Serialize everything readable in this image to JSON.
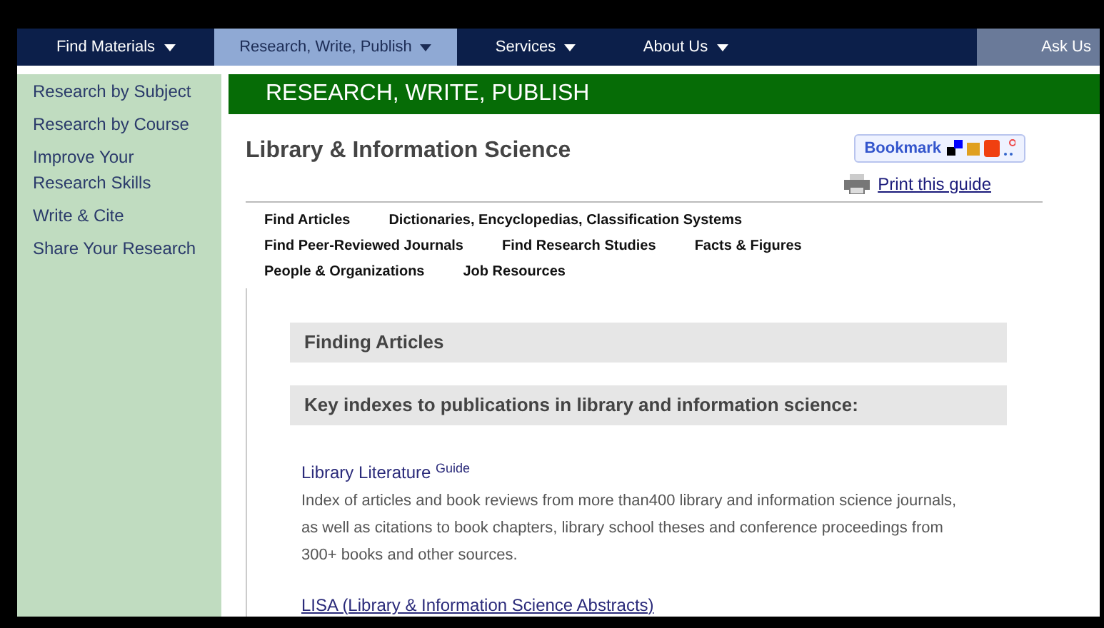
{
  "nav": [
    {
      "label": "Find Materials",
      "selected": false,
      "kind": "menu"
    },
    {
      "label": "Research, Write, Publish",
      "selected": true,
      "kind": "menu"
    },
    {
      "label": "Services",
      "selected": false,
      "kind": "menu"
    },
    {
      "label": "About Us",
      "selected": false,
      "kind": "menu"
    },
    {
      "label": "Ask Us",
      "selected": false,
      "kind": "button"
    }
  ],
  "sidebar": {
    "items": [
      "Research by Subject",
      "Research by Course",
      "Improve Your Research Skills",
      "Write & Cite",
      "Share Your Research"
    ]
  },
  "banner": "RESEARCH, WRITE, PUBLISH",
  "guide": {
    "title": "Library & Information Science",
    "bookmark": "Bookmark",
    "print": "Print this guide"
  },
  "tabs": [
    [
      "Find Articles",
      "Dictionaries, Encyclopedias, Classification Systems"
    ],
    [
      "Find Peer-Reviewed Journals",
      "Find Research Studies",
      "Facts & Figures"
    ],
    [
      "People & Organizations",
      "Job Resources"
    ]
  ],
  "sections": [
    {
      "heading": "Finding Articles"
    },
    {
      "heading": "Key indexes to publications in library and information science:"
    }
  ],
  "resources": [
    {
      "title": "Library Literature $^{Guide}$",
      "underline": false,
      "description": "Index of articles and book reviews from more than400 library and information science journals, as well as citations to book chapters, library school theses and conference proceedings from 300+ books and other sources."
    },
    {
      "title": "LISA (Library & Information Science Abstracts)",
      "underline": true
    }
  ]
}
